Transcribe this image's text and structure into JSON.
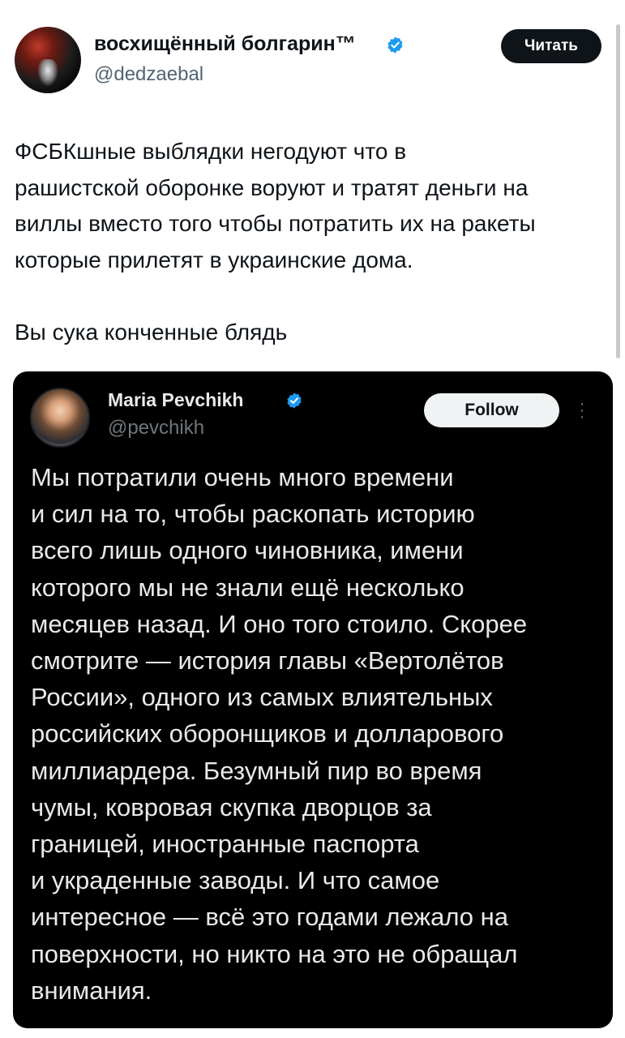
{
  "tweet": {
    "author": {
      "display_name": "восхищённый болгарин™",
      "handle": "@dedzaebal",
      "verified": true
    },
    "follow_label": "Читать",
    "paragraphs": [
      "ФСБКшные выблядки негодуют что в\nрашистской оборонке воруют и тратят деньги на\nвиллы вместо того чтобы потратить их на ракеты\nкоторые прилетят в украинские дома.",
      "Вы сука конченные блядь"
    ]
  },
  "quoted_tweet": {
    "author": {
      "display_name": "Maria Pevchikh",
      "handle": "@pevchikh",
      "verified": true
    },
    "follow_label": "Follow",
    "more_icon": "more-vertical-icon",
    "text": "Мы потратили очень много времени\nи сил на то, чтобы раскопать историю\nвсего лишь одного чиновника, имени\nкоторого мы не знали ещё несколько\nмесяцев назад. И оно того стоило. Скорее\nсмотрите — история главы «Вертолётов\nРоссии», одного из самых влиятельных\nроссийских оборонщиков и долларового\nмиллиардера. Безумный пир во время\nчумы, ковровая скупка дворцов за\nграницей, иностранные паспорта\nи украденные заводы. И что самое\nинтересное — всё это годами лежало на\nповерхности, но никто на это не обращал\nвнимания."
  },
  "colors": {
    "verified_blue": "#1d9bf0",
    "text_primary": "#0f1419",
    "text_secondary": "#536471",
    "quote_background": "#000000"
  }
}
